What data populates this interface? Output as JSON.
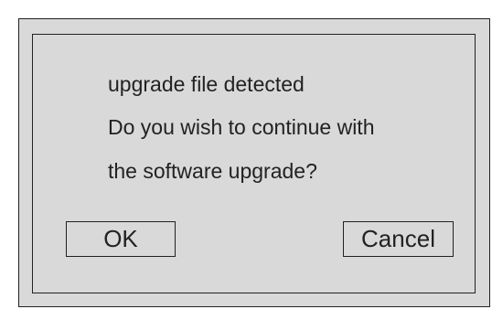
{
  "dialog": {
    "message_lines": [
      "upgrade file detected",
      "Do you wish to continue with",
      "the software upgrade?"
    ],
    "ok_label": "OK",
    "cancel_label": "Cancel"
  },
  "colors": {
    "panel_background": "#d9d9d9",
    "border": "#222222",
    "text": "#222222"
  }
}
